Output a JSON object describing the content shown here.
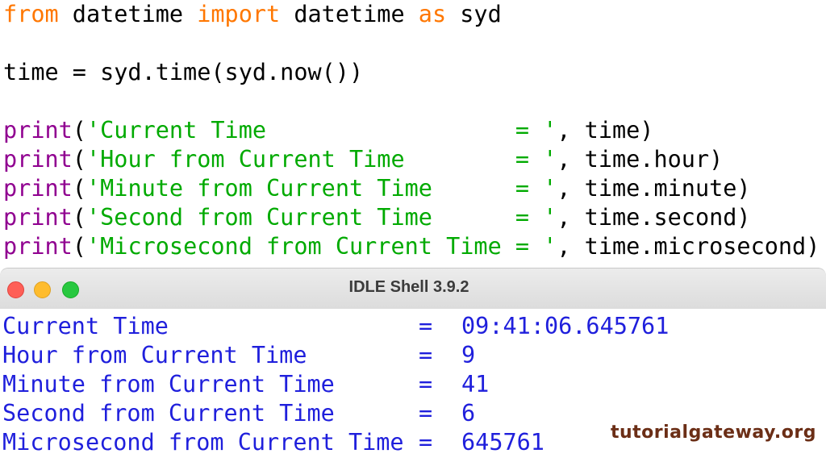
{
  "editor": {
    "line1": {
      "kw_from": "from",
      "mod": " datetime ",
      "kw_import": "import",
      "name": " datetime ",
      "kw_as": "as",
      "alias": " syd"
    },
    "line2": {
      "code": "time = syd.time(syd.now())"
    },
    "prints": [
      {
        "fn": "print",
        "open": "(",
        "str": "'Current Time                  = '",
        "rest": ", time)"
      },
      {
        "fn": "print",
        "open": "(",
        "str": "'Hour from Current Time        = '",
        "rest": ", time.hour)"
      },
      {
        "fn": "print",
        "open": "(",
        "str": "'Minute from Current Time      = '",
        "rest": ", time.minute)"
      },
      {
        "fn": "print",
        "open": "(",
        "str": "'Second from Current Time      = '",
        "rest": ", time.second)"
      },
      {
        "fn": "print",
        "open": "(",
        "str": "'Microsecond from Current Time = '",
        "rest": ", time.microsecond)"
      }
    ]
  },
  "window": {
    "title": "IDLE Shell 3.9.2"
  },
  "shell": {
    "output": [
      {
        "label": "Current Time",
        "eq": "=",
        "value": "09:41:06.645761"
      },
      {
        "label": "Hour from Current Time",
        "eq": "=",
        "value": "9"
      },
      {
        "label": "Minute from Current Time",
        "eq": "=",
        "value": "41"
      },
      {
        "label": "Second from Current Time",
        "eq": "=",
        "value": "6"
      },
      {
        "label": "Microsecond from Current Time",
        "eq": "=",
        "value": "645761"
      }
    ]
  },
  "watermark": "tutorialgateway.org",
  "colors": {
    "keyword": "#ff7700",
    "builtin": "#900090",
    "string": "#00aa00",
    "shell_output": "#1f1fdc",
    "watermark": "#6b2e16"
  }
}
